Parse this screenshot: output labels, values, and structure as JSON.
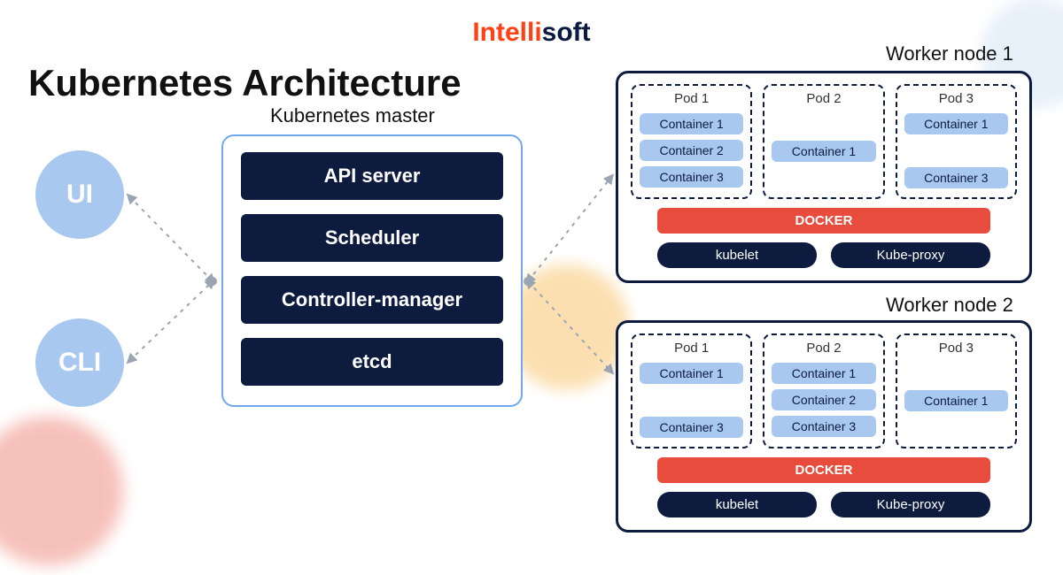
{
  "logo": {
    "accent": "Intelli",
    "rest": "soft"
  },
  "title": "Kubernetes Architecture",
  "clients": {
    "ui": "UI",
    "cli": "CLI"
  },
  "master": {
    "label": "Kubernetes master",
    "items": [
      "API server",
      "Scheduler",
      "Controller-manager",
      "etcd"
    ]
  },
  "workers": [
    {
      "label": "Worker node 1",
      "pods": [
        {
          "title": "Pod 1",
          "containers": [
            "Container 1",
            "Container 2",
            "Container 3"
          ]
        },
        {
          "title": "Pod 2",
          "containers": [
            "Container 1"
          ]
        },
        {
          "title": "Pod 3",
          "containers": [
            "Container 1",
            "",
            "Container 3"
          ]
        }
      ],
      "docker": "DOCKER",
      "services": [
        "kubelet",
        "Kube-proxy"
      ]
    },
    {
      "label": "Worker node 2",
      "pods": [
        {
          "title": "Pod 1",
          "containers": [
            "Container 1",
            "",
            "Container 3"
          ]
        },
        {
          "title": "Pod 2",
          "containers": [
            "Container 1",
            "Container 2",
            "Container 3"
          ]
        },
        {
          "title": "Pod 3",
          "containers": [
            "",
            "Container 1"
          ]
        }
      ],
      "docker": "DOCKER",
      "services": [
        "kubelet",
        "Kube-proxy"
      ]
    }
  ]
}
